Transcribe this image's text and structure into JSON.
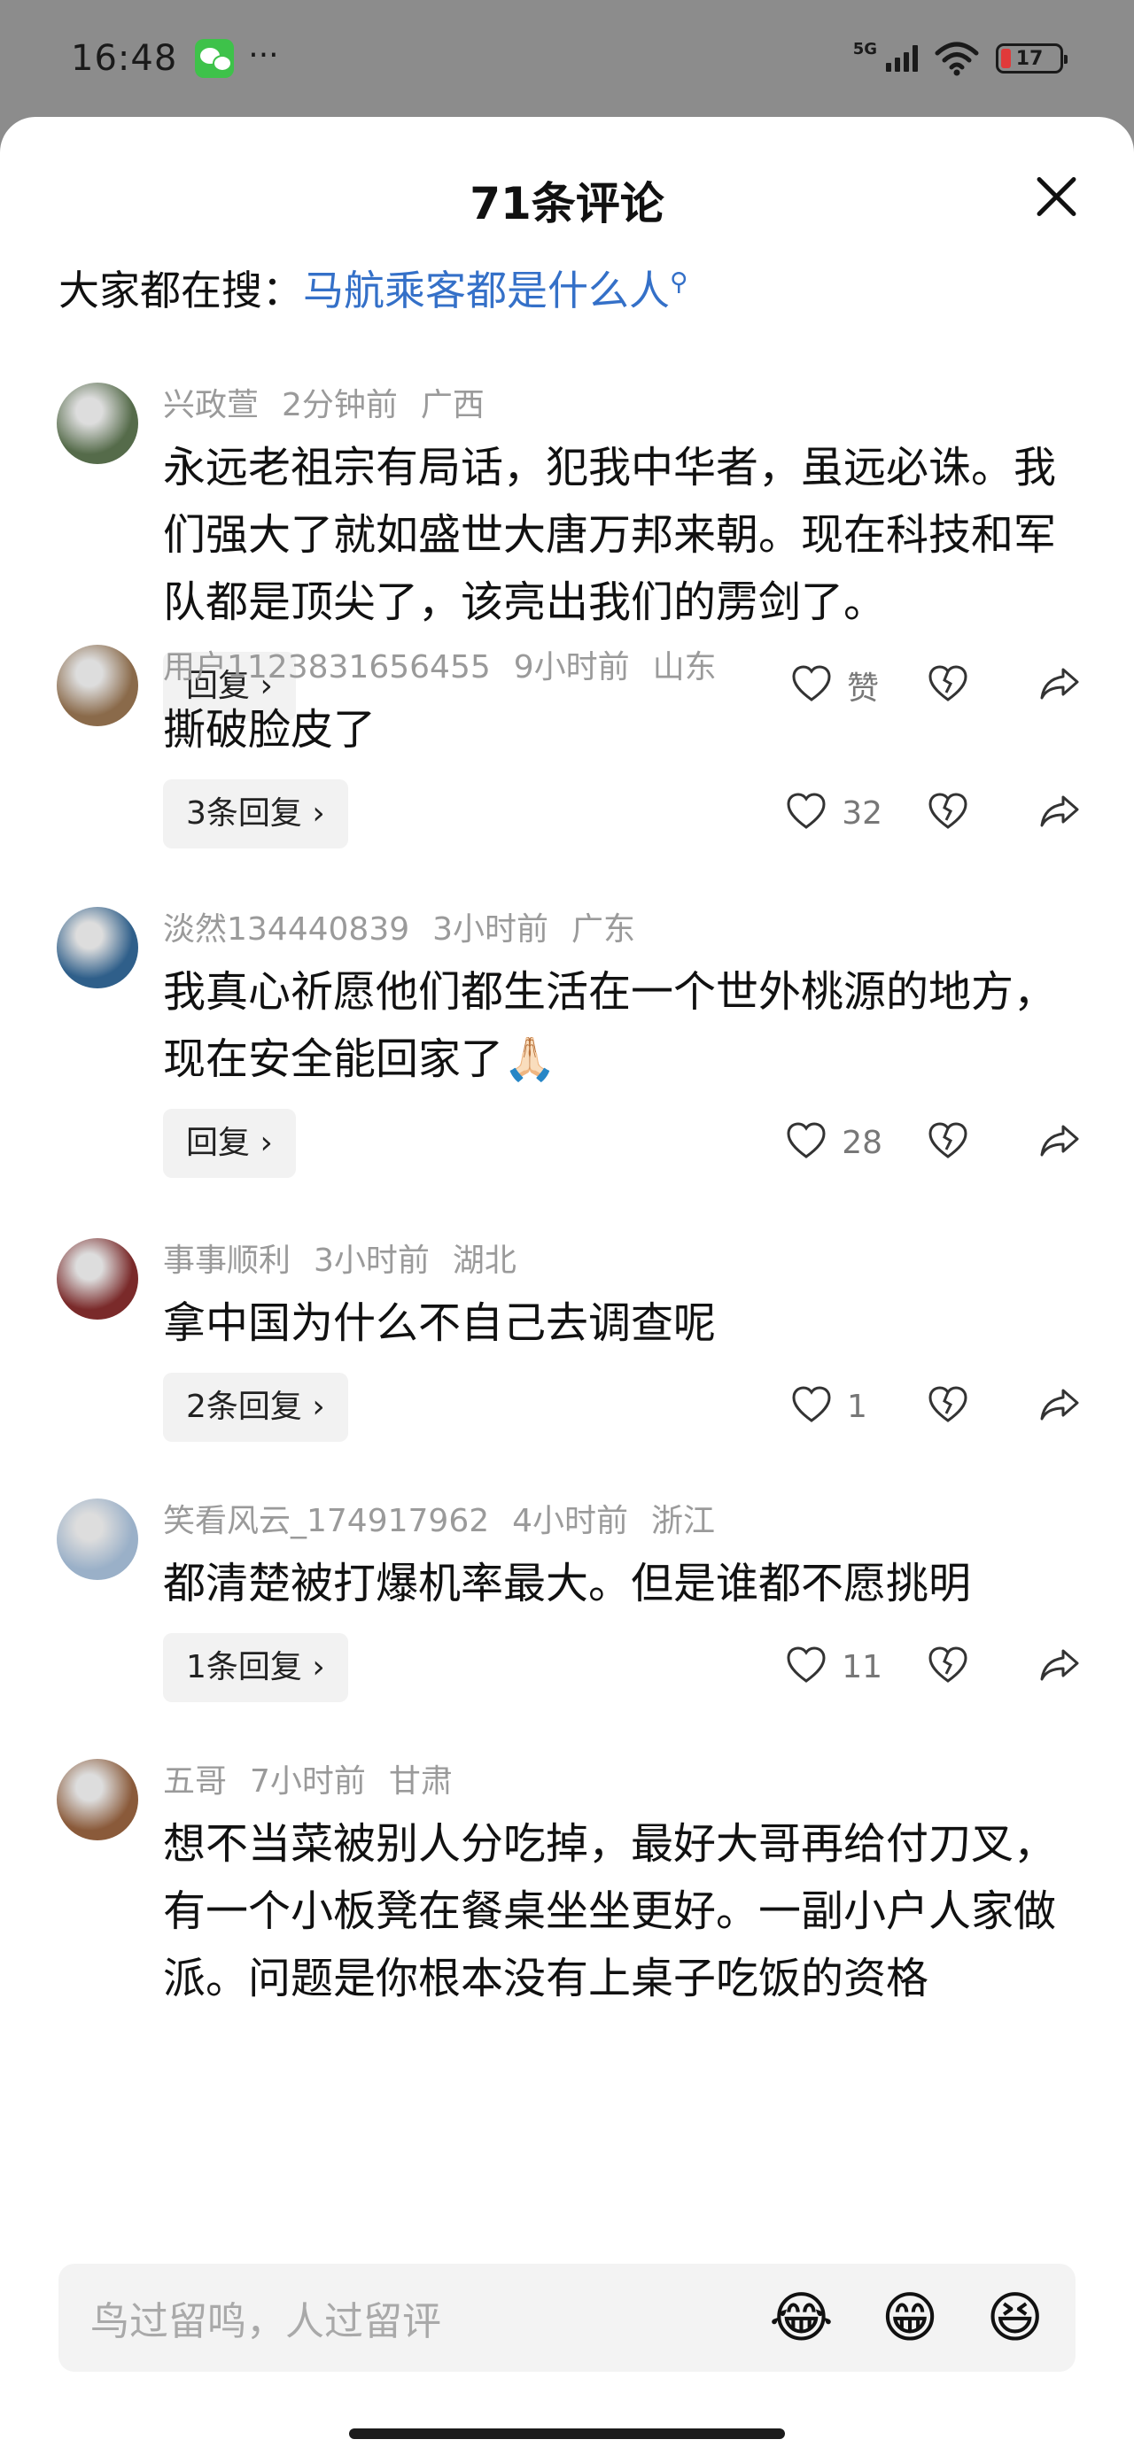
{
  "status": {
    "time": "16:48",
    "dots": "···",
    "net": "5G",
    "battery": "17"
  },
  "sheet": {
    "title": "71条评论",
    "hot_search_label": "大家都在搜：",
    "hot_search_link": "马航乘客都是什么人",
    "search_icon": "search-icon"
  },
  "comments": [
    {
      "user": "兴政萱",
      "time": "2分钟前",
      "region": "广西",
      "text": "永远老祖宗有局话，犯我中华者，虽远必诛。我们强大了就如盛世大唐万邦来朝。现在科技和军队都是顶尖了，该亮出我们的雳剑了。",
      "reply": "回复 ›",
      "likes": "赞",
      "avatar_color": "#556b4a"
    },
    {
      "user": "用户1123831656455",
      "time": "9小时前",
      "region": "山东",
      "text": "撕破脸皮了",
      "reply": "3条回复 ›",
      "likes": "32",
      "avatar_color": "#8a6a4a"
    },
    {
      "user": "淡然134440839",
      "time": "3小时前",
      "region": "广东",
      "text": "我真心祈愿他们都生活在一个世外桃源的地方，现在安全能回家了🙏🏻",
      "reply": "回复 ›",
      "likes": "28",
      "avatar_color": "#2f5f8a"
    },
    {
      "user": "事事顺利",
      "time": "3小时前",
      "region": "湖北",
      "text": "拿中国为什么不自己去调查呢",
      "reply": "2条回复 ›",
      "likes": "1",
      "avatar_color": "#7a2a2a"
    },
    {
      "user": "笑看风云_174917962",
      "time": "4小时前",
      "region": "浙江",
      "text": "都清楚被打爆机率最大。但是谁都不愿挑明",
      "reply": "1条回复 ›",
      "likes": "11",
      "avatar_color": "#9ab0c8"
    },
    {
      "user": "五哥",
      "time": "7小时前",
      "region": "甘肃",
      "text": "想不当菜被别人分吃掉，最好大哥再给付刀叉，有一个小板凳在餐桌坐坐更好。一副小户人家做派。问题是你根本没有上桌子吃饭的资格",
      "reply": "",
      "likes": "",
      "avatar_color": "#8a5a3a"
    }
  ],
  "input": {
    "placeholder": "鸟过留鸣，人过留评",
    "emojis": [
      "😂",
      "😁",
      "😆"
    ]
  }
}
